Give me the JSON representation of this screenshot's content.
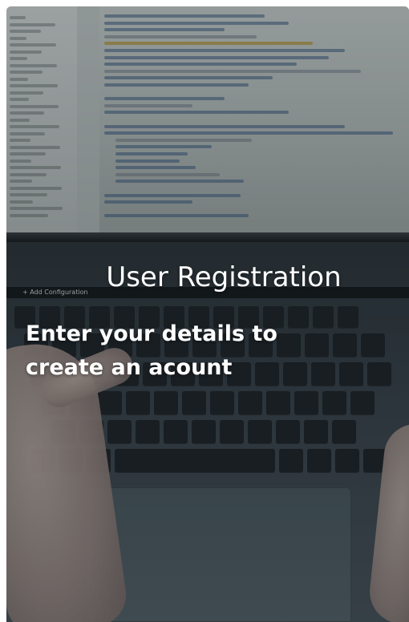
{
  "card": {
    "title": "User Registration",
    "subtitle": "Enter your details to create an acount"
  },
  "background": {
    "description_icon": "laptop-keyboard-photo",
    "ide_toolbar_label": "+ Add Configuration"
  },
  "colors": {
    "text": "#ffffff",
    "overlay": "#1e2226"
  }
}
